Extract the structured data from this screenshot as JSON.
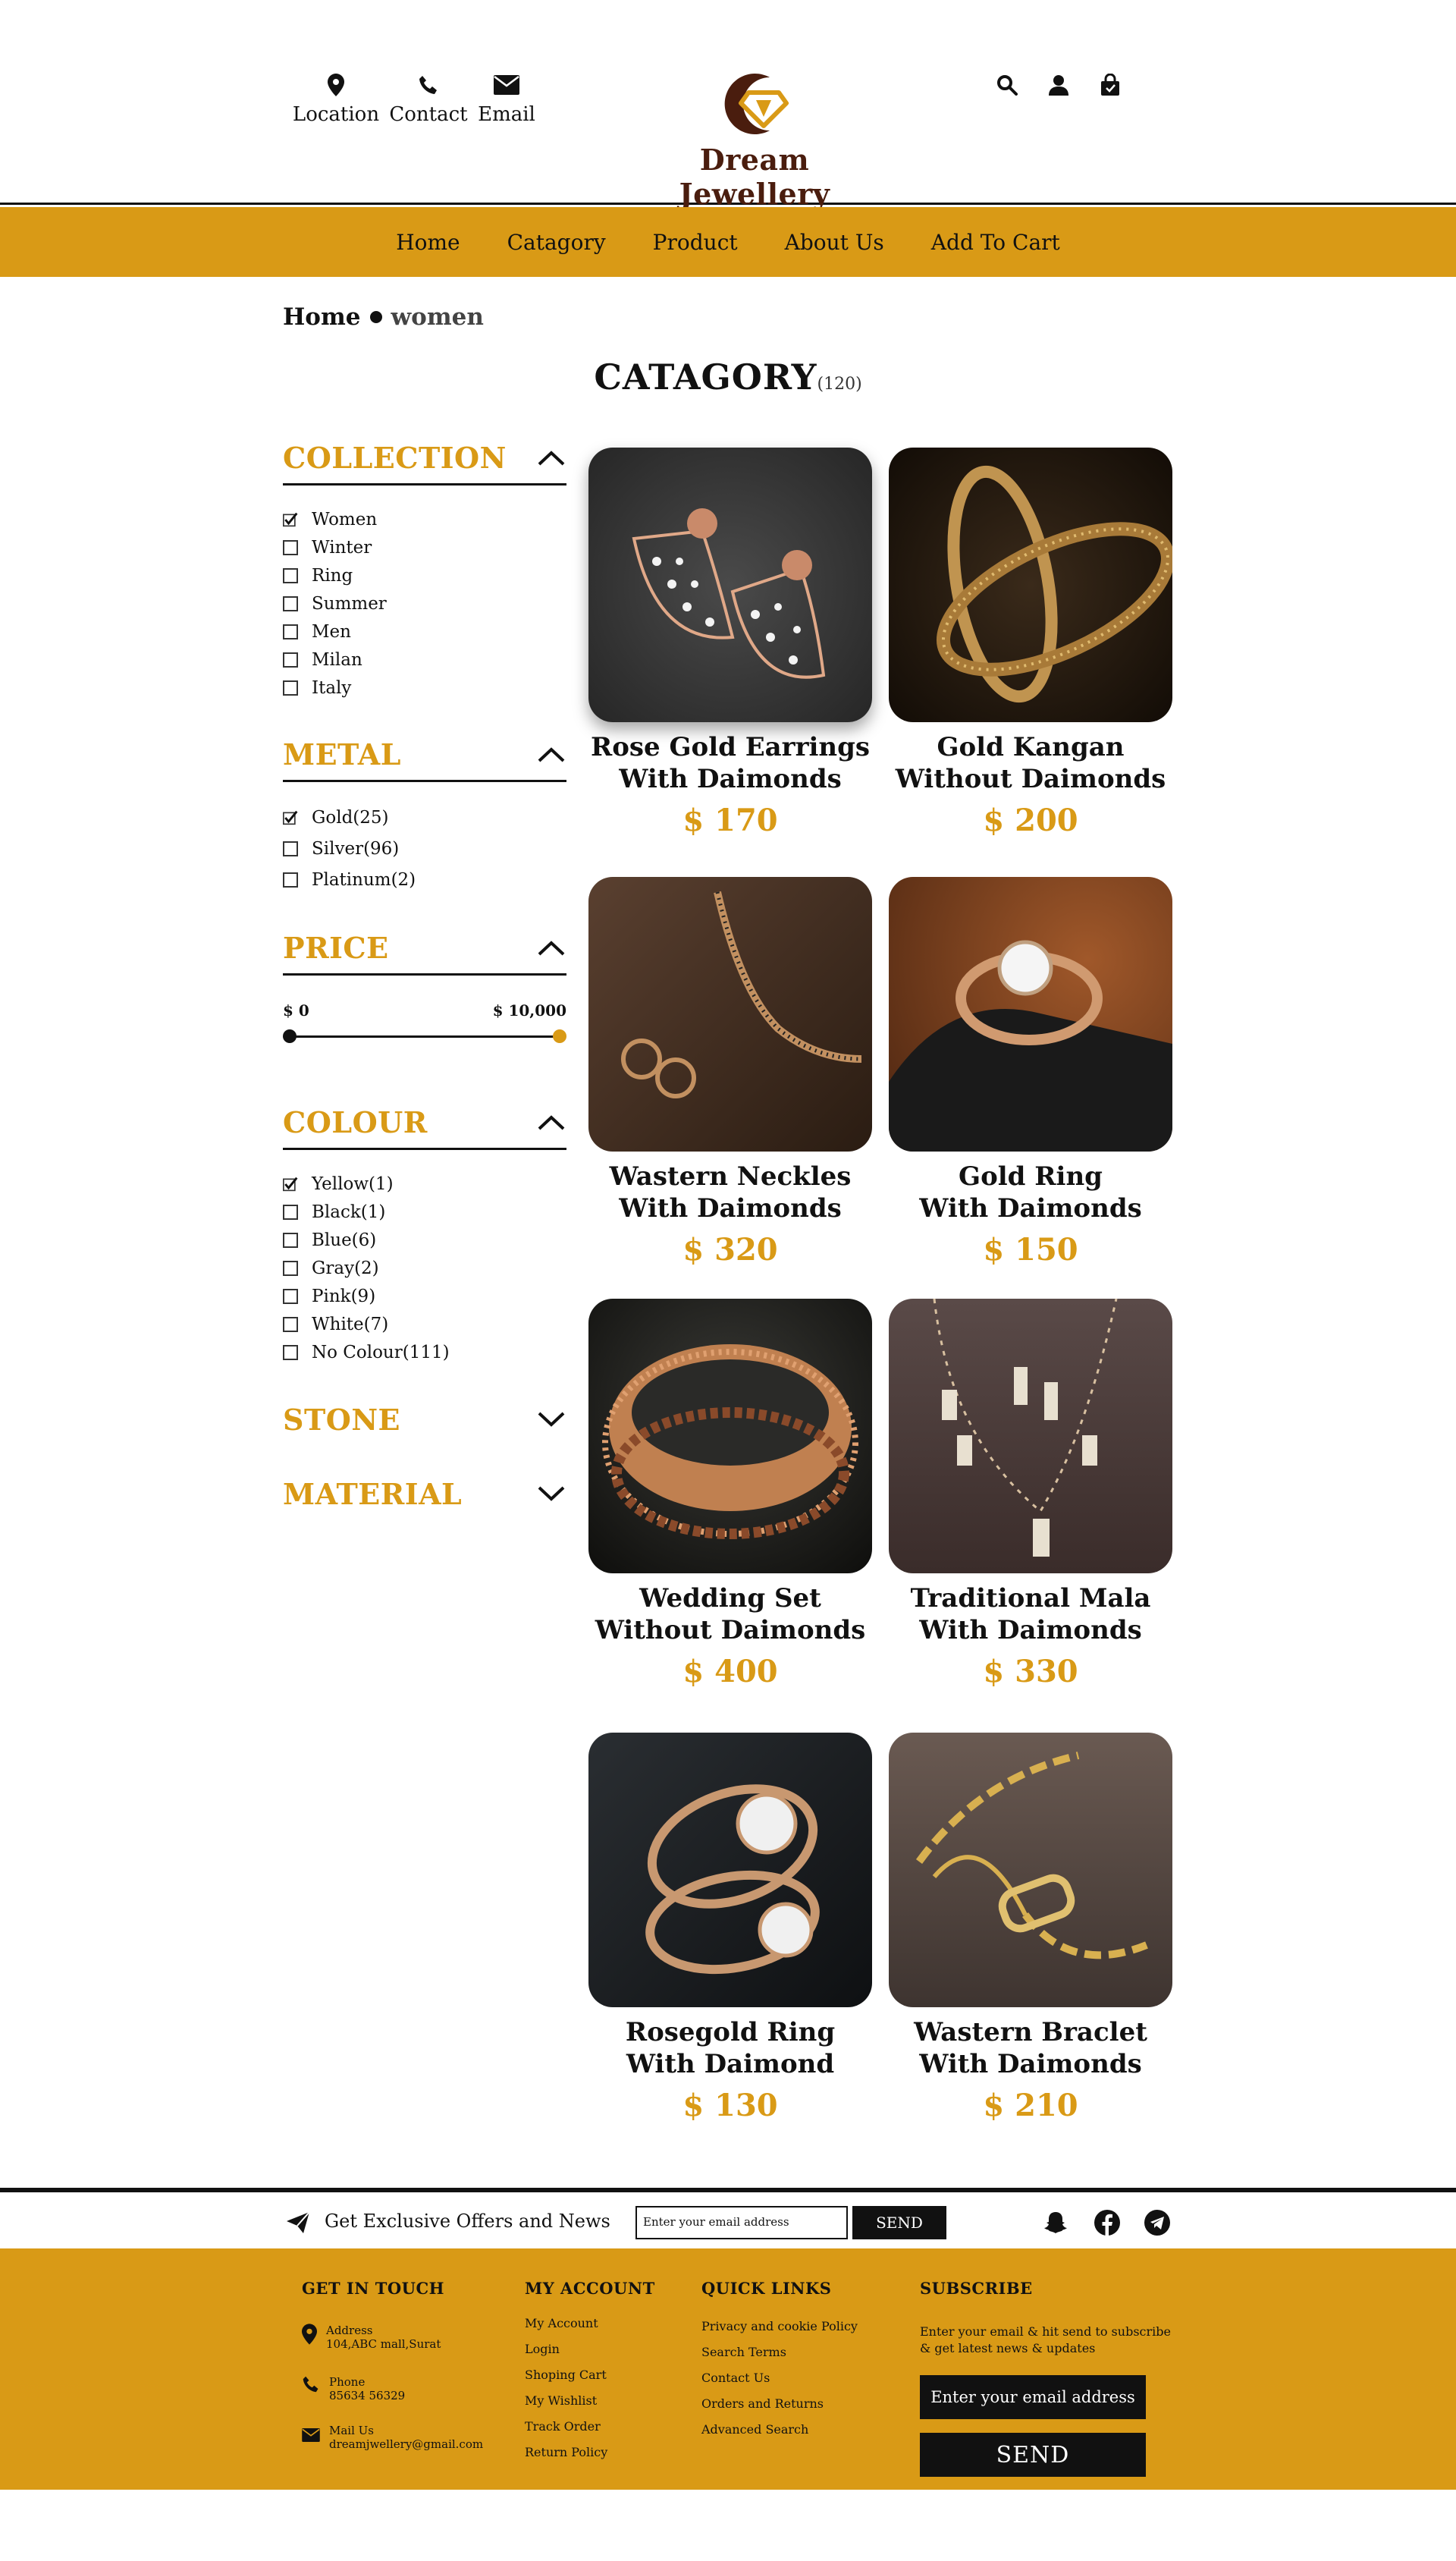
{
  "header": {
    "contacts": [
      {
        "icon": "location-pin-icon",
        "label": "Location"
      },
      {
        "icon": "phone-icon",
        "label": "Contact"
      },
      {
        "icon": "envelope-icon",
        "label": "Email"
      }
    ],
    "brand": "Dream Jewellery",
    "utilities": [
      "search-icon",
      "user-icon",
      "shopping-bag-icon"
    ]
  },
  "nav": {
    "items": [
      "Home",
      "Catagory",
      "Product",
      "About Us",
      "Add To Cart"
    ]
  },
  "breadcrumb": {
    "home": "Home",
    "current": "women"
  },
  "title": {
    "text": "CATAGORY",
    "count": "(120)"
  },
  "filters": {
    "collection": {
      "title": "COLLECTION",
      "options": [
        {
          "label": "Women",
          "checked": true
        },
        {
          "label": "Winter",
          "checked": false
        },
        {
          "label": "Ring",
          "checked": false
        },
        {
          "label": "Summer",
          "checked": false
        },
        {
          "label": "Men",
          "checked": false
        },
        {
          "label": "Milan",
          "checked": false
        },
        {
          "label": "Italy",
          "checked": false
        }
      ]
    },
    "metal": {
      "title": "METAL",
      "options": [
        {
          "label": "Gold(25)",
          "checked": true
        },
        {
          "label": "Silver(96)",
          "checked": false
        },
        {
          "label": "Platinum(2)",
          "checked": false
        }
      ]
    },
    "price": {
      "title": "PRICE",
      "min_label": "$ 0",
      "max_label": "$ 10,000"
    },
    "colour": {
      "title": "COLOUR",
      "options": [
        {
          "label": "Yellow(1)",
          "checked": true
        },
        {
          "label": "Black(1)",
          "checked": false
        },
        {
          "label": "Blue(6)",
          "checked": false
        },
        {
          "label": "Gray(2)",
          "checked": false
        },
        {
          "label": "Pink(9)",
          "checked": false
        },
        {
          "label": "White(7)",
          "checked": false
        },
        {
          "label": "No Colour(111)",
          "checked": false
        }
      ]
    },
    "stone": {
      "title": "STONE"
    },
    "material": {
      "title": "MATERIAL"
    }
  },
  "products": [
    {
      "name1": "Rose Gold Earrings",
      "name2": "With Daimonds",
      "price": "$ 170"
    },
    {
      "name1": "Gold Kangan",
      "name2": "Without Daimonds",
      "price": "$ 200"
    },
    {
      "name1": "Wastern Neckles",
      "name2": "With Daimonds",
      "price": "$ 320"
    },
    {
      "name1": "Gold Ring",
      "name2": "With Daimonds",
      "price": "$ 150"
    },
    {
      "name1": "Wedding Set",
      "name2": "Without Daimonds",
      "price": "$ 400"
    },
    {
      "name1": "Traditional Mala",
      "name2": "With Daimonds",
      "price": "$ 330"
    },
    {
      "name1": "Rosegold Ring",
      "name2": "With Daimond",
      "price": "$ 130"
    },
    {
      "name1": "Wastern Braclet",
      "name2": "With Daimonds",
      "price": "$ 210"
    }
  ],
  "newsletter": {
    "text": "Get Exclusive Offers and News",
    "placeholder": "Enter your email address",
    "button": "SEND",
    "socials": [
      "snapchat-icon",
      "facebook-icon",
      "telegram-icon"
    ]
  },
  "footer": {
    "get_in_touch": {
      "title": "GET IN TOUCH",
      "address_label": "Address",
      "address": "104,ABC mall,Surat",
      "phone_label": "Phone",
      "phone": "85634 56329",
      "mail_label": "Mail Us",
      "mail": "dreamjwellery@gmail.com"
    },
    "my_account": {
      "title": "MY ACCOUNT",
      "links": [
        "My Account",
        "Login",
        "Shoping Cart",
        "My Wishlist",
        "Track Order",
        "Return Policy"
      ]
    },
    "quick_links": {
      "title": "QUICK LINKS",
      "links": [
        "Privacy and cookie Policy",
        "Search Terms",
        "Contact Us",
        "Orders and Returns",
        "Advanced Search"
      ]
    },
    "subscribe": {
      "title": "SUBSCRIBE",
      "desc": "Enter your email & hit send to subscribe & get latest news & updates",
      "placeholder": "Enter your email address",
      "button": "SEND"
    }
  },
  "colors": {
    "accent": "#d99a16",
    "dark": "#111111",
    "brand_text": "#4a1d0e"
  }
}
